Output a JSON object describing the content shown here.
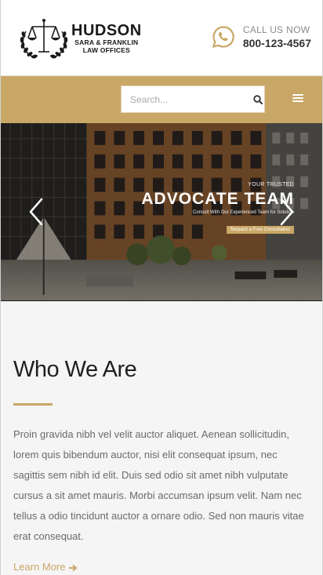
{
  "header": {
    "logo": {
      "name": "HUDSON",
      "line1": "SARA & FRANKLIN",
      "line2": "LAW OFFICES"
    },
    "call": {
      "label": "CALL US NOW",
      "number": "800-123-4567",
      "icon": "whatsapp-icon"
    }
  },
  "search": {
    "placeholder": "Search...",
    "icon": "search-icon"
  },
  "menu": {
    "icon": "hamburger-menu-icon"
  },
  "hero": {
    "eyebrow": "YOUR TRUSTED",
    "title": "ADVOCATE TEAM",
    "subtitle": "Consult With Our Experienced Team for Solution",
    "cta": "Request a Free Consultation",
    "prev_icon": "chevron-left-icon",
    "next_icon": "chevron-right-icon"
  },
  "about": {
    "title": "Who We Are",
    "body": "Proin gravida nibh vel velit auctor aliquet. Aenean sollicitudin, lorem quis bibendum auctor, nisi elit consequat ipsum, nec sagittis sem nibh id elit. Duis sed odio sit amet nibh vulputate cursus a sit amet mauris. Morbi accumsan ipsum velit. Nam nec tellus a odio tincidunt auctor a ornare odio. Sed non mauris vitae erat consequat.",
    "link": "Learn More"
  },
  "colors": {
    "accent": "#c9a766",
    "text": "#6a6a6a",
    "heading": "#1f1f1f"
  }
}
